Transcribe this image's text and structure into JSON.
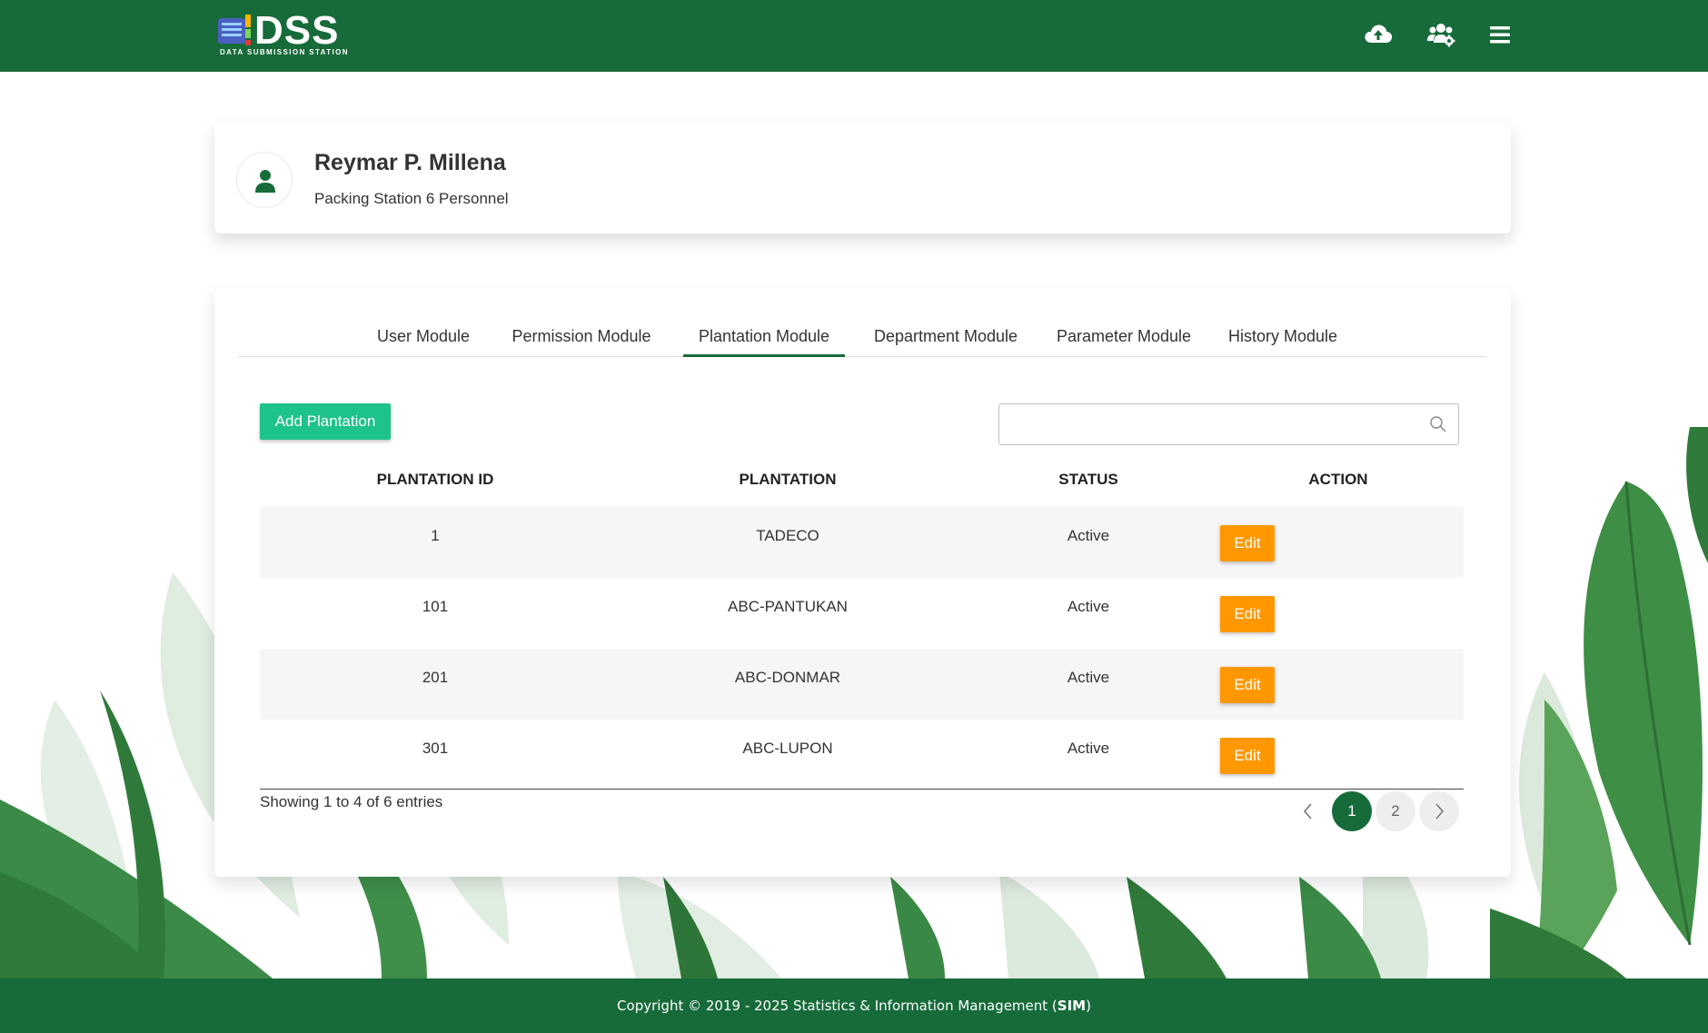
{
  "colors": {
    "brand_green": "#176b3a",
    "add_button": "#1ec28b",
    "edit_button": "#ff9800",
    "page_current": "#176b3a"
  },
  "header": {
    "logo_text": "DSS",
    "logo_subtitle": "DATA SUBMISSION STATION",
    "icons": [
      "cloud-upload-icon",
      "users-settings-icon",
      "menu-icon"
    ]
  },
  "profile": {
    "name": "Reymar P. Millena",
    "role": "Packing Station 6 Personnel",
    "avatar_icon": "user-icon"
  },
  "tabs": [
    {
      "label": "User Module",
      "active": false
    },
    {
      "label": "Permission Module",
      "active": false
    },
    {
      "label": "Plantation Module",
      "active": true
    },
    {
      "label": "Department Module",
      "active": false
    },
    {
      "label": "Parameter Module",
      "active": false
    },
    {
      "label": "History Module",
      "active": false
    }
  ],
  "toolbar": {
    "add_label": "Add Plantation",
    "search_value": "",
    "search_icon": "search-icon"
  },
  "table": {
    "columns": [
      "PLANTATION ID",
      "PLANTATION",
      "STATUS",
      "ACTION"
    ],
    "rows": [
      {
        "id": "1",
        "plantation": "TADECO",
        "status": "Active",
        "action": "Edit"
      },
      {
        "id": "101",
        "plantation": "ABC-PANTUKAN",
        "status": "Active",
        "action": "Edit"
      },
      {
        "id": "201",
        "plantation": "ABC-DONMAR",
        "status": "Active",
        "action": "Edit"
      },
      {
        "id": "301",
        "plantation": "ABC-LUPON",
        "status": "Active",
        "action": "Edit"
      }
    ]
  },
  "pagination": {
    "summary": "Showing 1 to 4 of 6 entries",
    "pages": [
      "1",
      "2"
    ],
    "current_page": "1"
  },
  "footer": {
    "text_before": "Copyright © 2019 - 2025 Statistics & Information Management (",
    "text_bold": "SIM",
    "text_after": ")"
  }
}
